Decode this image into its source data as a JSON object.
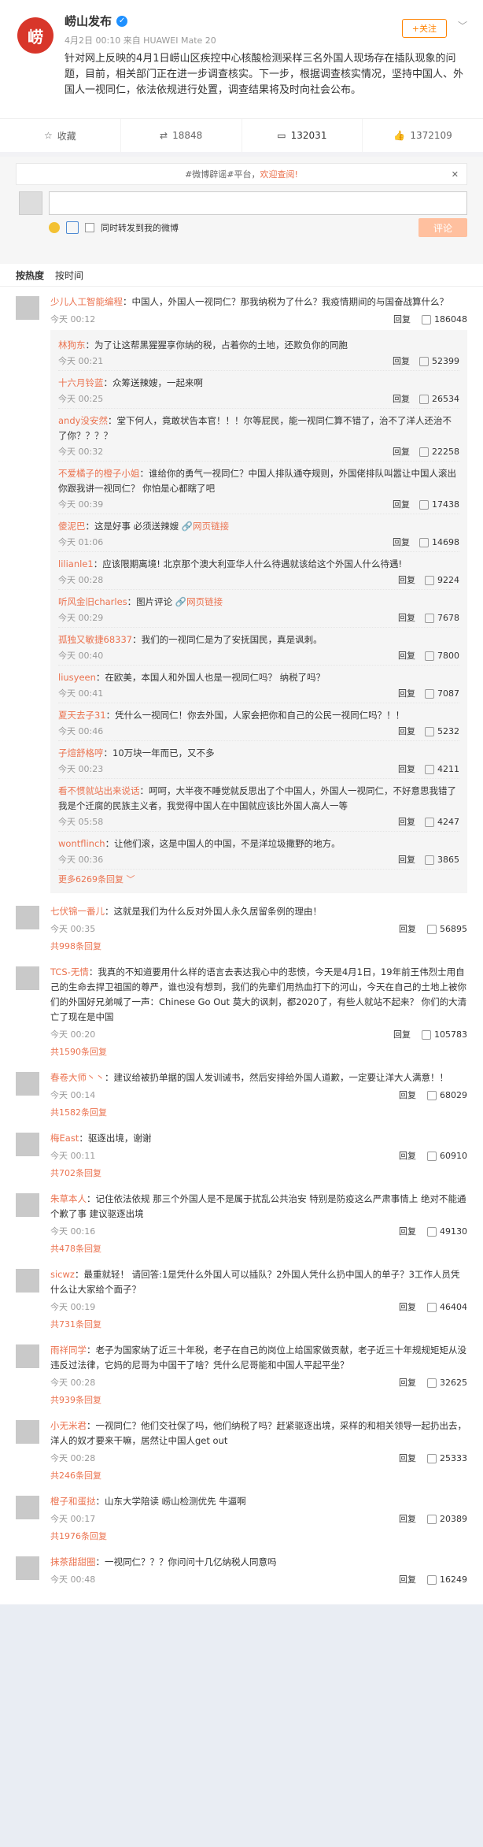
{
  "post": {
    "author": "崂山发布",
    "verified_icon": "v-badge-icon",
    "follow_label": "+关注",
    "meta": "4月2日 00:10 来自 HUAWEI Mate 20",
    "text": "针对网上反映的4月1日崂山区疾控中心核酸检测采样三名外国人现场存在插队现象的问题，目前，相关部门正在进一步调查核实。下一步，根据调查核实情况，坚持中国人、外国人一视同仁，依法依规进行处置，调查结果将及时向社会公布。",
    "logo_text": "崂"
  },
  "actions": {
    "collect": "收藏",
    "repost": "18848",
    "comment": "132031",
    "like": "1372109"
  },
  "comment_box": {
    "notice_prefix": "#微博辟谣#平台，",
    "notice_link": "欢迎查阅!",
    "repost_label": "同时转发到我的微博",
    "submit": "评论"
  },
  "sort": {
    "hot": "按热度",
    "time": "按时间"
  },
  "comments": [
    {
      "name": "少儿人工智能编程",
      "text": "：中国人，外国人一视同仁？那我纳税为了什么？我疫情期间的与国奋战算什么？",
      "time": "今天 00:12",
      "reply": "回复",
      "likes": "186048",
      "replies": [
        {
          "name": "林狗东",
          "text": "：为了让这帮黑猩猩享你纳的税，占着你的土地，还欺负你的同胞",
          "time": "今天 00:21",
          "reply": "回复",
          "likes": "52399"
        },
        {
          "name": "十六月铃蓝",
          "text": "：众筹送辣嫂，一起来啊",
          "time": "今天 00:25",
          "reply": "回复",
          "likes": "26534"
        },
        {
          "name": "andy没安然",
          "text": "：堂下何人，竟敢状告本官！！！尔等屁民，能一视同仁算不错了，治不了洋人还治不了你？？？？",
          "time": "今天 00:32",
          "reply": "回复",
          "likes": "22258"
        },
        {
          "name": "不爱橘子的橙子小姐",
          "text": "：谁给你的勇气一视同仁？中国人排队通夺规则，外国佬排队叫嚣让中国人滚出 你跟我讲一视同仁？ 你怕是心都瞎了吧",
          "time": "今天 00:39",
          "reply": "回复",
          "likes": "17438"
        },
        {
          "name": "傻泥巴",
          "text": "：这是好事 必须送辣嫂 ",
          "link": "网页链接",
          "time": "今天 01:06",
          "reply": "回复",
          "likes": "14698"
        },
        {
          "name": "lilianle1",
          "text": "：应该限期离境! 北京那个澳大利亚华人什么待遇就该给这个外国人什么待遇!",
          "time": "今天 00:28",
          "reply": "回复",
          "likes": "9224"
        },
        {
          "name": "听风金旧charles",
          "text": "：图片评论 ",
          "link": "网页链接",
          "time": "今天 00:29",
          "reply": "回复",
          "likes": "7678"
        },
        {
          "name": "孤独又敏捷68337",
          "text": "：我们的一视同仁是为了安抚国民，真是讽刺。",
          "time": "今天 00:40",
          "reply": "回复",
          "likes": "7800"
        },
        {
          "name": "liusyeen",
          "text": "：在欧美，本国人和外国人也是一视同仁吗？ 纳税了吗？",
          "time": "今天 00:41",
          "reply": "回复",
          "likes": "7087"
        },
        {
          "name": "夏天去子31",
          "text": "：凭什么一视同仁！你去外国，人家会把你和自己的公民一视同仁吗？！！",
          "time": "今天 00:46",
          "reply": "回复",
          "likes": "5232"
        },
        {
          "name": "子煊舒格哼",
          "text": "：10万块一年而已，又不多",
          "time": "今天 00:23",
          "reply": "回复",
          "likes": "4211"
        },
        {
          "name": "看不惯就站出来说话",
          "text": "：呵呵，大半夜不睡觉就反思出了个中国人，外国人一视同仁，不好意思我错了我是个迁腐的民族主义者，我觉得中国人在中国就应该比外国人高人一等",
          "time": "今天 05:58",
          "reply": "回复",
          "likes": "4247"
        },
        {
          "name": "wontflinch",
          "text": "：让他们滚，这是中国人的中国，不是洋垃圾撒野的地方。",
          "time": "今天 00:36",
          "reply": "回复",
          "likes": "3865"
        }
      ],
      "more": "更多6269条回复"
    },
    {
      "name": "七伏锦一番儿",
      "text": "：这就是我们为什么反对外国人永久居留条例的理由！",
      "time": "今天 00:35",
      "reply": "回复",
      "likes": "56895",
      "total": "共998条回复"
    },
    {
      "name": "TCS-无情",
      "text": "：我真的不知道要用什么样的语言去表达我心中的悲愤，今天是4月1日，19年前王伟烈士用自己的生命去捍卫祖国的尊严，谁也没有想到，我们的先辈们用热血打下的河山，今天在自己的土地上被你们的外国好兄弟喊了一声：Chinese Go Out 莫大的讽刺，都2020了，有些人就站不起来？ 你们的大清亡了现在是中国",
      "time": "今天 00:20",
      "reply": "回复",
      "likes": "105783",
      "total": "共1590条回复"
    },
    {
      "name": "春卷大师丶丶",
      "text": "：建议给被扔单据的国人发训诫书，然后安排给外国人道歉，一定要让洋大人满意！！",
      "time": "今天 00:14",
      "reply": "回复",
      "likes": "68029",
      "total": "共1582条回复"
    },
    {
      "name": "梅East",
      "text": "：驱逐出境，谢谢",
      "time": "今天 00:11",
      "reply": "回复",
      "likes": "60910",
      "total": "共702条回复"
    },
    {
      "name": "朱草本人",
      "text": "：记住依法依规 那三个外国人是不是属于扰乱公共治安 特别是防疫这么严肃事情上 绝对不能通个歉了事 建议驱逐出境",
      "time": "今天 00:16",
      "reply": "回复",
      "likes": "49130",
      "total": "共478条回复"
    },
    {
      "name": "sicwz",
      "text": "：最重就轻！ 请回答:1是凭什么外国人可以插队？2外国人凭什么扔中国人的单子？3工作人员凭什么让大家给个面子？",
      "time": "今天 00:19",
      "reply": "回复",
      "likes": "46404",
      "total": "共731条回复"
    },
    {
      "name": "雨祥同学",
      "text": "：老子为国家纳了近三十年税，老子在自己的岗位上给国家做贡献，老子近三十年规规矩矩从没违反过法律，它妈的尼哥为中国干了啥？凭什么尼哥能和中国人平起平坐？",
      "time": "今天 00:28",
      "reply": "回复",
      "likes": "32625",
      "total": "共939条回复"
    },
    {
      "name": "小无米君",
      "text": "：一视同仁？他们交社保了吗，他们纳税了吗？赶紧驱逐出境，采样的和相关领导一起扔出去，洋人的奴才要来干嘛，居然让中国人get out",
      "time": "今天 00:28",
      "reply": "回复",
      "likes": "25333",
      "total": "共246条回复"
    },
    {
      "name": "橙子和蛋挞",
      "text": "：山东大学陪读 崂山检测优先 牛逼啊",
      "time": "今天 00:17",
      "reply": "回复",
      "likes": "20389",
      "total": "共1976条回复"
    },
    {
      "name": "抹茶甜甜圈",
      "text": "：一视同仁？？？你问问十几亿纳税人同意吗",
      "time": "今天 00:48",
      "reply": "回复",
      "likes": "16249"
    }
  ]
}
